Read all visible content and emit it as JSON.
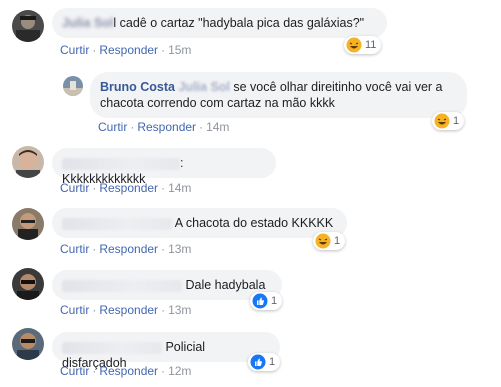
{
  "actions": {
    "like": "Curtir",
    "reply": "Responder",
    "separator": "·"
  },
  "comments": [
    {
      "author": "Julia Sol",
      "text": "l cadê o cartaz \"hadybala pica das galáxias?\"",
      "time": "15m",
      "reaction": {
        "type": "haha",
        "count": "11"
      }
    },
    {
      "author": "Bruno Costa",
      "tag": "Julia Sol",
      "text": " se você olhar direitinho você vai ver a",
      "text2": "chacota correndo com cartaz na mão kkkk",
      "time": "14m",
      "reaction": {
        "type": "haha",
        "count": "1"
      }
    },
    {
      "text": ": Kkkkkkkkkkkkk",
      "time": "14m"
    },
    {
      "text": " A chacota do estado KKKKK",
      "time": "13m",
      "reaction": {
        "type": "haha",
        "count": "1"
      }
    },
    {
      "text": " Dale hadybala",
      "time": "13m",
      "reaction": {
        "type": "like",
        "count": "1"
      }
    },
    {
      "text": " Policial disfarçadoh",
      "time": "12m",
      "reaction": {
        "type": "like",
        "count": "1"
      }
    }
  ],
  "colors": {
    "link": "#4267b2",
    "bubble": "#f2f3f5",
    "haha": "#f7b125",
    "like": "#1877f2"
  }
}
